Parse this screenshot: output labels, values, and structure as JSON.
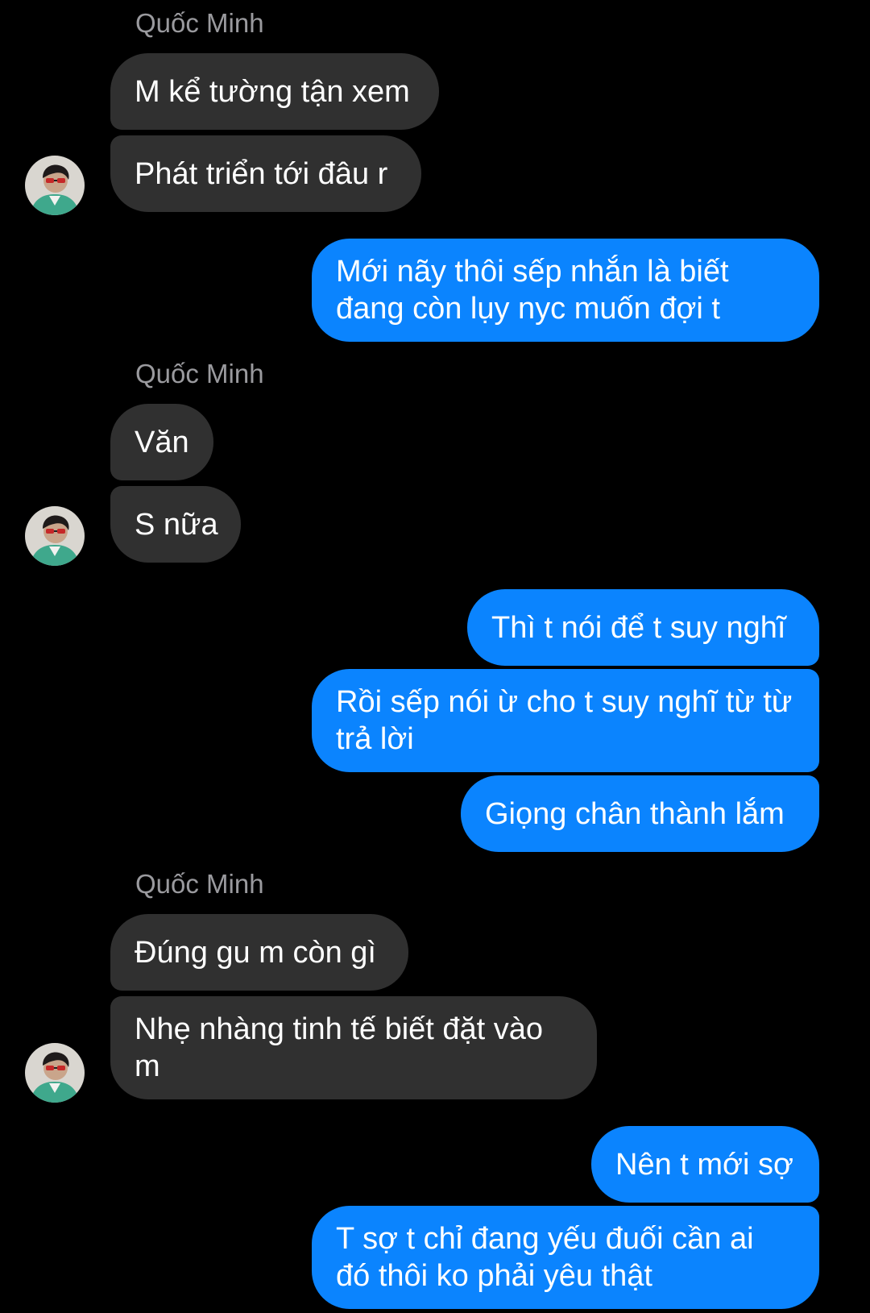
{
  "contact": {
    "name": "Quốc Minh"
  },
  "colors": {
    "background": "#000000",
    "incoming_bubble": "#303030",
    "outgoing_bubble": "#0b84fe",
    "sender_name": "#9a9a9e"
  },
  "messages": {
    "g1_name": "Quốc Minh",
    "m1": "M kể tường tận xem",
    "m2": "Phát triển tới đâu r",
    "m3": "Mới nãy thôi sếp nhắn là biết đang còn lụy nyc muốn đợi t",
    "g2_name": "Quốc Minh",
    "m4": "Văn",
    "m5": "S nữa",
    "m6": "Thì t nói để t suy nghĩ",
    "m7": "Rồi sếp nói ừ cho t suy nghĩ từ từ trả lời",
    "m8": "Giọng chân thành lắm",
    "g3_name": "Quốc Minh",
    "m9": "Đúng gu m còn gì",
    "m10": "Nhẹ nhàng tinh tế biết đặt vào m",
    "m11": "Nên t mới sợ",
    "m12": "T sợ t chỉ đang yếu đuối cần ai đó thôi ko phải yêu thật"
  },
  "avatar_icon": "person-photo"
}
